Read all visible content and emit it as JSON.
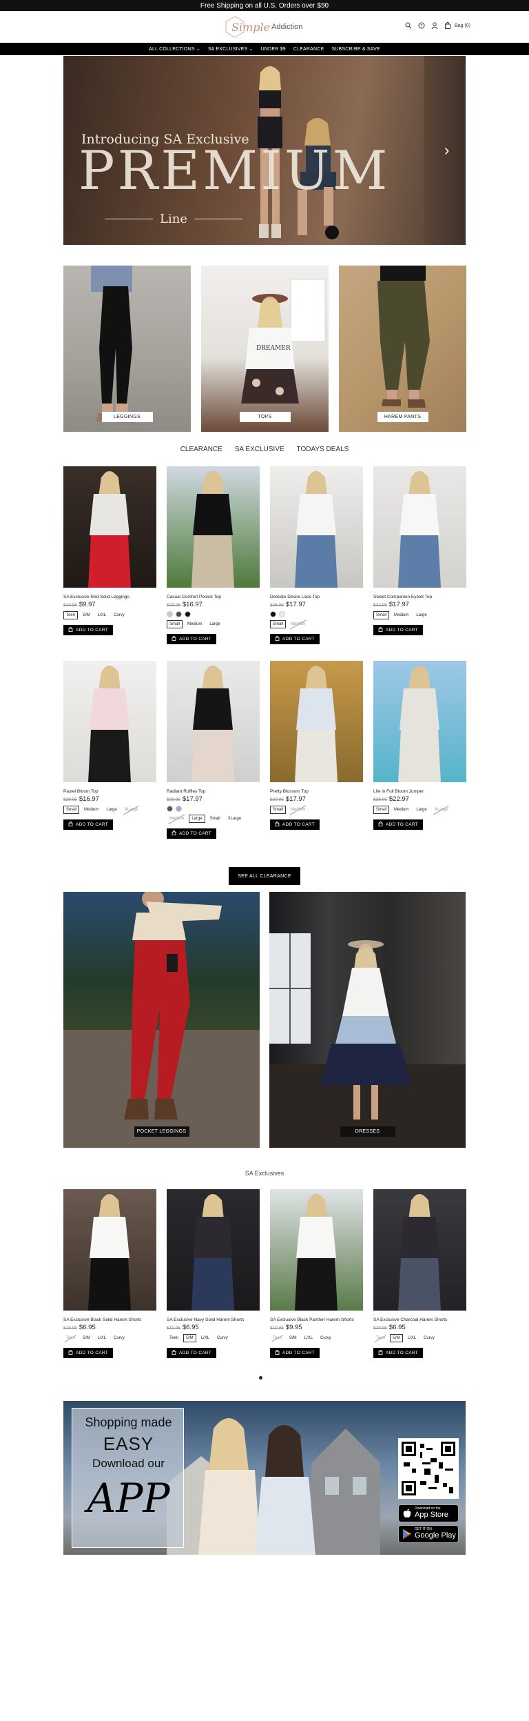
{
  "announcement": {
    "text": "Free Shipping on all U.S. Orders over $50",
    "close": "×"
  },
  "header": {
    "logo_script": "Simple",
    "logo_word": "Addiction",
    "bag_label": "Bag (0)"
  },
  "nav": {
    "items": [
      "ALL COLLECTIONS ⌄",
      "SA EXCLUSIVES ⌄",
      "UNDER $9",
      "CLEARANCE",
      "SUBSCRIBE & SAVE"
    ]
  },
  "hero": {
    "intro": "Introducing SA Exclusive",
    "headline": "PREMIUM",
    "subline": "Line",
    "arrow": "›"
  },
  "categories": [
    {
      "label": "LEGGINGS"
    },
    {
      "label": "TOPS"
    },
    {
      "label": "HAREM PANTS"
    }
  ],
  "tabs": [
    "CLEARANCE",
    "SA EXCLUSIVE",
    "TODAYS DEALS"
  ],
  "clearance_products": [
    {
      "title": "SA Exclusive Red Solid Leggings",
      "old_price": "$19.95",
      "price": "$9.97",
      "swatches": [],
      "sizes": [
        {
          "label": "Teen",
          "state": "sel"
        },
        {
          "label": "S/M",
          "state": ""
        },
        {
          "label": "L/XL",
          "state": ""
        },
        {
          "label": "Curvy",
          "state": ""
        }
      ],
      "atc": "ADD TO CART"
    },
    {
      "title": "Casual Comfort Pocket Top",
      "old_price": "$29.95",
      "price": "$16.97",
      "swatches": [
        "#c9c9c9",
        "#4a4a4a",
        "#111111"
      ],
      "sizes": [
        {
          "label": "Small",
          "state": "sel"
        },
        {
          "label": "Medium",
          "state": ""
        },
        {
          "label": "Large",
          "state": ""
        }
      ],
      "atc": "ADD TO CART"
    },
    {
      "title": "Delicate Desire Lace Top",
      "old_price": "$26.95",
      "price": "$17.97",
      "swatches": [
        "#111111",
        "#f2e6da"
      ],
      "sizes": [
        {
          "label": "Small",
          "state": "sel"
        },
        {
          "label": "Medium",
          "state": "out"
        }
      ],
      "atc": "ADD TO CART"
    },
    {
      "title": "Sweet Companion Eyelet Top",
      "old_price": "$32.95",
      "price": "$17.97",
      "swatches": [],
      "sizes": [
        {
          "label": "Small",
          "state": "sel"
        },
        {
          "label": "Medium",
          "state": ""
        },
        {
          "label": "Large",
          "state": ""
        }
      ],
      "atc": "ADD TO CART"
    },
    {
      "title": "Pastel Bloom Top",
      "old_price": "$29.95",
      "price": "$16.97",
      "swatches": [],
      "sizes": [
        {
          "label": "Small",
          "state": "sel"
        },
        {
          "label": "Medium",
          "state": ""
        },
        {
          "label": "Large",
          "state": ""
        },
        {
          "label": "XLarge",
          "state": "out"
        }
      ],
      "atc": "ADD TO CART"
    },
    {
      "title": "Radiant Ruffles Top",
      "old_price": "$29.95",
      "price": "$17.97",
      "swatches": [
        "#555555",
        "#9bb0c8"
      ],
      "sizes": [
        {
          "label": "Medium",
          "state": "out"
        },
        {
          "label": "Large",
          "state": "sel"
        },
        {
          "label": "Small",
          "state": ""
        },
        {
          "label": "XLarge",
          "state": ""
        }
      ],
      "atc": "ADD TO CART"
    },
    {
      "title": "Pretty Blossom Top",
      "old_price": "$30.95",
      "price": "$17.97",
      "swatches": [],
      "sizes": [
        {
          "label": "Small",
          "state": "sel"
        },
        {
          "label": "Medium",
          "state": "out"
        }
      ],
      "atc": "ADD TO CART"
    },
    {
      "title": "Life in Full Bloom Jumper",
      "old_price": "$38.95",
      "price": "$22.97",
      "swatches": [],
      "sizes": [
        {
          "label": "Small",
          "state": "sel"
        },
        {
          "label": "Medium",
          "state": ""
        },
        {
          "label": "Large",
          "state": ""
        },
        {
          "label": "XLarge",
          "state": "out"
        }
      ],
      "atc": "ADD TO CART"
    }
  ],
  "see_all": "SEE ALL CLEARANCE",
  "featured": [
    {
      "label": "POCKET LEGGINGS"
    },
    {
      "label": "DRESSES"
    }
  ],
  "sa_title": "SA Exclusives",
  "sa_products": [
    {
      "title": "SA Exclusive Black Solid Harem Shorts",
      "old_price": "$19.95",
      "price": "$6.95",
      "swatches": [],
      "sizes": [
        {
          "label": "Teen",
          "state": "out"
        },
        {
          "label": "S/M",
          "state": ""
        },
        {
          "label": "L/XL",
          "state": ""
        },
        {
          "label": "Curvy",
          "state": ""
        }
      ],
      "atc": "ADD TO CART"
    },
    {
      "title": "SA Exclusive Navy Solid Harem Shorts",
      "old_price": "$19.95",
      "price": "$6.95",
      "swatches": [],
      "sizes": [
        {
          "label": "Teen",
          "state": ""
        },
        {
          "label": "S/M",
          "state": "sel"
        },
        {
          "label": "L/XL",
          "state": ""
        },
        {
          "label": "Curvy",
          "state": ""
        }
      ],
      "atc": "ADD TO CART"
    },
    {
      "title": "SA Exclusive Black Panther Harem Shorts",
      "old_price": "$19.95",
      "price": "$9.95",
      "swatches": [],
      "sizes": [
        {
          "label": "Teen",
          "state": "out"
        },
        {
          "label": "S/M",
          "state": ""
        },
        {
          "label": "L/XL",
          "state": ""
        },
        {
          "label": "Curvy",
          "state": ""
        }
      ],
      "atc": "ADD TO CART"
    },
    {
      "title": "SA Exclusive Charcoal Harem Shorts",
      "old_price": "$19.95",
      "price": "$6.95",
      "swatches": [],
      "sizes": [
        {
          "label": "Teen",
          "state": "out"
        },
        {
          "label": "S/M",
          "state": "sel"
        },
        {
          "label": "L/XL",
          "state": ""
        },
        {
          "label": "Curvy",
          "state": ""
        }
      ],
      "atc": "ADD TO CART"
    }
  ],
  "app_banner": {
    "line1": "Shopping made",
    "line2": "EASY",
    "line3": "Download our",
    "line4": "APP",
    "appstore_small": "Download on the",
    "appstore_big": "App Store",
    "play_small": "GET IT ON",
    "play_big": "Google Play"
  },
  "colors": {
    "black": "#000000",
    "accent": "#c98d7a"
  }
}
